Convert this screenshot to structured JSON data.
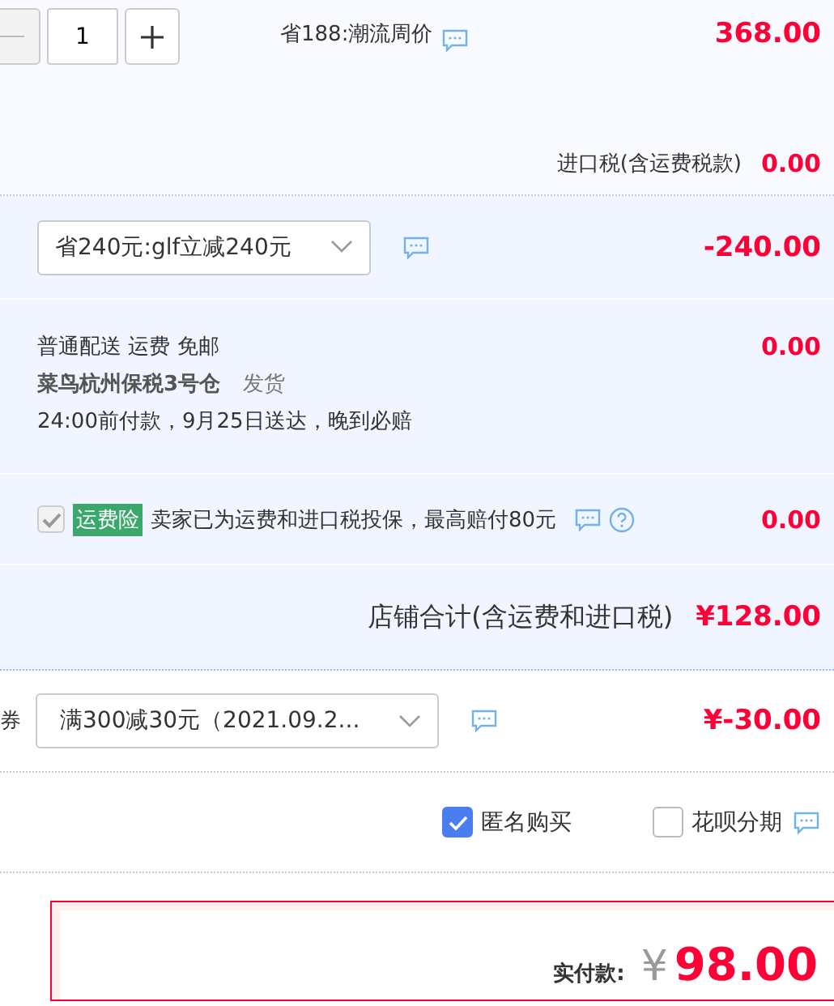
{
  "item": {
    "quantity": "1",
    "promo_label": "省188:潮流周价",
    "price": "368.00",
    "tax_label": "进口税(含运费税款)",
    "tax_value": "0.00"
  },
  "discount": {
    "value": "省240元:glf立减240元",
    "amount": "-240.00"
  },
  "delivery": {
    "line_1": "普通配送 运费 免邮",
    "warehouse": "菜鸟杭州保税3号仓",
    "ship_text": "发货",
    "line_3": "24:00前付款，9月25日送达，晚到必赔",
    "amount": "0.00"
  },
  "insurance": {
    "checked": true,
    "disabled": true,
    "tag": "运费险",
    "text": "卖家已为运费和进口税投保，最高赔付80元",
    "amount": "0.00"
  },
  "store_total": {
    "label": "店铺合计(含运费和进口税)",
    "amount": "¥128.00"
  },
  "coupon": {
    "label": "券",
    "value": "满300减30元（2021.09.2...",
    "amount": "¥-30.00"
  },
  "options": [
    {
      "label": "匿名购买",
      "checked": true
    },
    {
      "label": "花呗分期",
      "checked": false
    }
  ],
  "payment": {
    "label": "实付款:",
    "currency": "¥",
    "amount": "98.00"
  }
}
